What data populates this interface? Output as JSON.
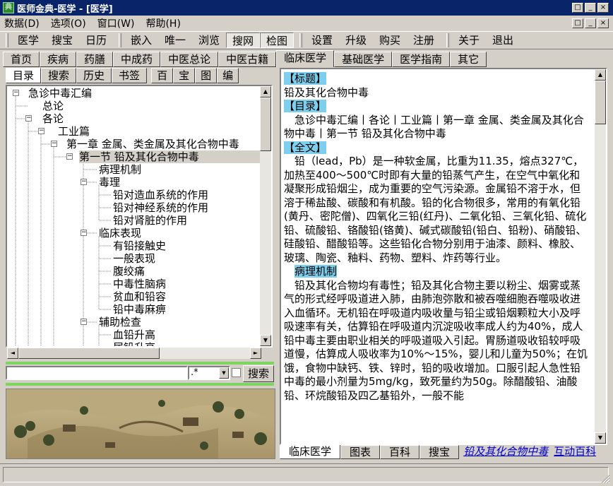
{
  "window": {
    "title": "医师金典-医学 - [医学]",
    "icon_label": "典"
  },
  "menu": [
    "数据(D)",
    "选项(O)",
    "窗口(W)",
    "帮助(H)"
  ],
  "toolbar": {
    "group1": [
      "医学",
      "搜宝",
      "日历"
    ],
    "group2": [
      "嵌入",
      "唯一",
      "浏览",
      "搜网",
      "检图"
    ],
    "group3": [
      "设置",
      "升级",
      "购买",
      "注册"
    ],
    "group4": [
      "关于",
      "退出"
    ]
  },
  "top_tabs": [
    "首页",
    "疾病",
    "药膳",
    "中成药",
    "中医总论",
    "中医古籍",
    "临床医学",
    "基础医学",
    "医学指南",
    "其它"
  ],
  "left_tabs": [
    "目录",
    "搜索",
    "历史",
    "书签",
    "百",
    "宝",
    "图",
    "编"
  ],
  "tree": [
    {
      "label": "急诊中毒汇编",
      "box": "-"
    },
    {
      "label": "总论"
    },
    {
      "label": "各论",
      "box": "-"
    },
    {
      "label": "工业篇",
      "box": "-"
    },
    {
      "label": "第一章 金属、类金属及其化合物中毒",
      "box": "-"
    },
    {
      "label": "第一节 铅及其化合物中毒",
      "box": "-"
    },
    {
      "label": "病理机制"
    },
    {
      "label": "毒理",
      "box": "-"
    },
    {
      "label": "铅对造血系统的作用"
    },
    {
      "label": "铅对神经系统的作用"
    },
    {
      "label": "铅对肾脏的作用"
    },
    {
      "label": "临床表现",
      "box": "-"
    },
    {
      "label": "有铅接触史"
    },
    {
      "label": "一般表现"
    },
    {
      "label": "腹绞痛"
    },
    {
      "label": "中毒性脑病"
    },
    {
      "label": "贫血和铅容"
    },
    {
      "label": "铅中毒麻痹"
    },
    {
      "label": "辅助检查",
      "box": "-"
    },
    {
      "label": "血铅升高"
    },
    {
      "label": "尿铅升高"
    }
  ],
  "search": {
    "input_value": "",
    "regex": ".*",
    "button": "搜索"
  },
  "content": {
    "title_tag": "【标题】",
    "title": "铅及其化合物中毒",
    "catalog_tag": "【目录】",
    "catalog": "急诊中毒汇编丨各论丨工业篇丨第一章 金属、类金属及其化合物中毒丨第一节 铅及其化合物中毒",
    "fulltext_tag": "【全文】",
    "paragraph1": "铅（lead，Pb）是一种软金属，比重为11.35，熔点327℃，加热至400～500℃时即有大量的铅蒸气产生，在空气中氧化和凝聚形成铅烟尘，成为重要的空气污染源。金属铅不溶于水，但溶于稀盐酸、碳酸和有机酸。铅的化合物很多，常用的有氧化铅(黄丹、密陀僧)、四氧化三铅(红丹)、二氧化铅、三氧化铅、硫化铅、硫酸铅、铬酸铅(铬黄)、碱式碳酸铅(铅白、铅粉)、硝酸铅、硅酸铅、醋酸铅等。这些铅化合物分别用于油漆、颜料、橡胶、玻璃、陶瓷、釉料、药物、塑料、炸药等行业。",
    "section_tag": "病理机制",
    "paragraph2": "铅及其化合物均有毒性；铅及其化合物主要以粉尘、烟雾或蒸气的形式经呼吸道进入肺，由肺泡弥散和被吞噬细胞吞噬吸收进入血循环。无机铅在呼吸道内吸收量与铅尘或铅烟颗粒大小及呼吸速率有关，估算铅在呼吸道内沉淀吸收率成人约为40%，成人铅中毒主要由职业相关的呼吸道吸入引起。胃肠道吸收铅较呼吸道慢，估算成人吸收率为10%～15%，婴儿和儿童为50%；在饥饿，食物中缺钙、铁、锌时，铅的吸收增加。口服引起人急性铅中毒的最小剂量为5mg/kg，致死量约为50g。除醋酸铅、油酸铅、环烷酸铅及四乙基铅外，一般不能"
  },
  "bottom_tabs": [
    "临床医学",
    "图表",
    "百科",
    "搜宝"
  ],
  "bottom_links": [
    "铅及其化合物中毒",
    "互动百科"
  ],
  "window_buttons": {
    "minimize": "_",
    "restore": "□",
    "close": "×"
  },
  "scroll": {
    "up": "▲",
    "down": "▼",
    "left": "◄",
    "right": "►"
  },
  "colors": {
    "titlebar": "#0a246a",
    "highlight": "#7ecfee",
    "greenbar": "#7fd45f",
    "link": "#0000cc"
  }
}
